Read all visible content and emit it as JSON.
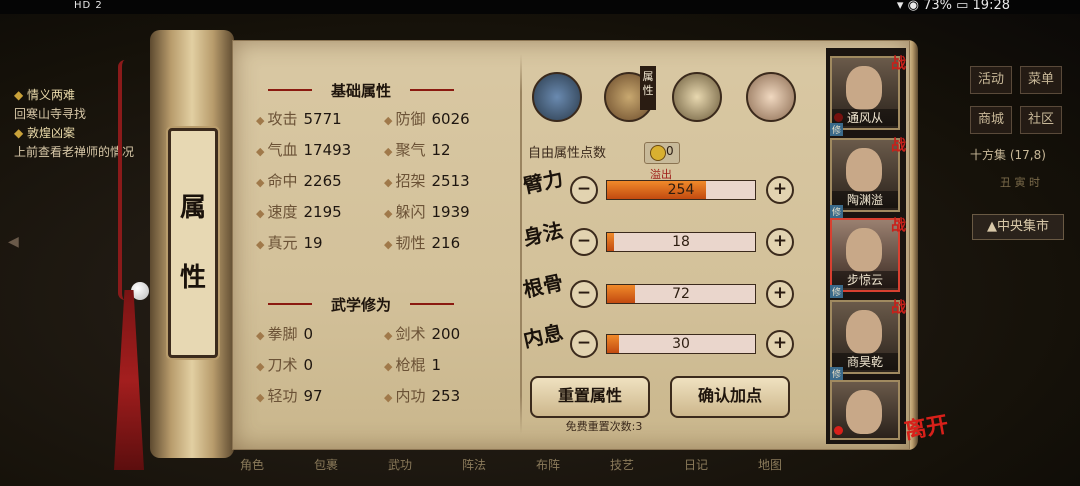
{
  "status_bar": {
    "left": "HD 2",
    "battery": "73%",
    "time": "19:28"
  },
  "background": {
    "quests": [
      {
        "title": "情义两难",
        "desc": "回寒山寺寻找"
      },
      {
        "title": "敦煌凶案",
        "desc": "上前查看老禅师的情况"
      }
    ],
    "menu": {
      "activity": "活动",
      "menu": "菜单",
      "shop": "商城",
      "community": "社区",
      "market": "十方集",
      "market_count": "(17,8)",
      "time": "丑 寅 时",
      "location": "中央集市"
    },
    "bottom_bar": [
      "角色",
      "包裹",
      "武功",
      "阵法",
      "布阵",
      "技艺",
      "日记",
      "地图"
    ]
  },
  "scroll_label": [
    "属",
    "性"
  ],
  "basic": {
    "title": "基础属性",
    "stats": [
      {
        "name": "攻击",
        "value": "5771"
      },
      {
        "name": "防御",
        "value": "6026"
      },
      {
        "name": "气血",
        "value": "17493"
      },
      {
        "name": "聚气",
        "value": "12"
      },
      {
        "name": "命中",
        "value": "2265"
      },
      {
        "name": "招架",
        "value": "2513"
      },
      {
        "name": "速度",
        "value": "2195"
      },
      {
        "name": "躲闪",
        "value": "1939"
      },
      {
        "name": "真元",
        "value": "19"
      },
      {
        "name": "韧性",
        "value": "216"
      }
    ]
  },
  "martial": {
    "title": "武学修为",
    "stats": [
      {
        "name": "拳脚",
        "value": "0"
      },
      {
        "name": "剑术",
        "value": "200"
      },
      {
        "name": "刀术",
        "value": "0"
      },
      {
        "name": "枪棍",
        "value": "1"
      },
      {
        "name": "轻功",
        "value": "97"
      },
      {
        "name": "内功",
        "value": "253"
      }
    ]
  },
  "tabs": [
    {
      "icon": "hat-icon"
    },
    {
      "icon": "scroll-icon",
      "label": "属性"
    },
    {
      "icon": "bagua-icon"
    },
    {
      "icon": "body-icon"
    }
  ],
  "free_points": {
    "label": "自由属性点数",
    "value": "0"
  },
  "attributes": [
    {
      "name": "臂力",
      "value": "254",
      "fill": 0.67,
      "overflow": "溢出"
    },
    {
      "name": "身法",
      "value": "18",
      "fill": 0.05
    },
    {
      "name": "根骨",
      "value": "72",
      "fill": 0.19
    },
    {
      "name": "内息",
      "value": "30",
      "fill": 0.08
    }
  ],
  "buttons": {
    "reset": "重置属性",
    "confirm": "确认加点"
  },
  "free_reset": "免费重置次数:3",
  "party": [
    {
      "name": "通风从",
      "tag": "战",
      "mark": "修"
    },
    {
      "name": "陶渊溢",
      "tag": "战",
      "mark": "修"
    },
    {
      "name": "步惊云",
      "tag": "战",
      "mark": "修"
    },
    {
      "name": "商昊乾",
      "tag": "战",
      "mark": "修"
    },
    {
      "name": "",
      "tag": "",
      "mark": ""
    }
  ],
  "leave": "离开",
  "colors": {
    "accent_red": "#c8201a",
    "bar_fill": "#e0701e",
    "paper": "#d6c49e"
  }
}
